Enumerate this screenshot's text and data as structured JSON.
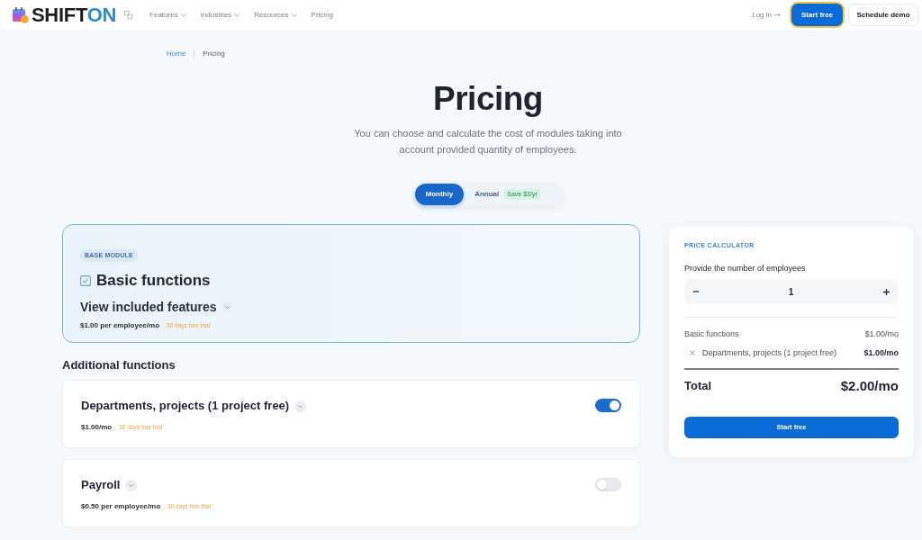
{
  "header": {
    "logo": {
      "main": "SHIFT",
      "accent": "ON"
    },
    "nav": [
      {
        "label": "Features",
        "dropdown": true
      },
      {
        "label": "Industries",
        "dropdown": true
      },
      {
        "label": "Resources",
        "dropdown": true
      },
      {
        "label": "Pricing",
        "dropdown": false
      }
    ],
    "login": "Log in",
    "buttons": [
      {
        "label": "Start free",
        "kind": "primary",
        "focused": true
      },
      {
        "label": "Schedule demo",
        "kind": "secondary",
        "focused": false
      }
    ]
  },
  "breadcrumb": [
    {
      "label": "Home",
      "kind": "link"
    },
    {
      "label": "Pricing",
      "kind": "current"
    }
  ],
  "title": "Pricing",
  "subtitle": "You can choose and calculate the cost of modules taking into account provided quantity of employees.",
  "billing_tabs": [
    {
      "label": "Monthly",
      "selected": true
    },
    {
      "label": "Annual",
      "selected": false,
      "badge": "Save $3/yr"
    }
  ],
  "base_module": {
    "badge": "BASE MODULE",
    "title": "Basic functions",
    "expander": "View included features",
    "price": "$1.00 per employee/mo",
    "trial": "30 days free trial"
  },
  "additional_heading": "Additional functions",
  "additional_functions": [
    {
      "title": "Departments, projects (1 project free)",
      "price": "$1.00/mo",
      "trial": "30 days free trial",
      "on": true
    },
    {
      "title": "Payroll",
      "price": "$0.50 per employee/mo",
      "trial": "30 days free trial",
      "on": false
    }
  ],
  "calculator": {
    "label": "PRICE CALCULATOR",
    "employees_label": "Provide the number of employees",
    "employees_value": "1",
    "lines": [
      {
        "name": "Basic functions",
        "amount": "$1.00/mo",
        "removable": false
      },
      {
        "name": "Departments, projects (1 project free)",
        "amount": "$1.00/mo",
        "removable": true
      }
    ],
    "total_label": "Total",
    "total": "$2.00/mo",
    "button": "Start free"
  }
}
